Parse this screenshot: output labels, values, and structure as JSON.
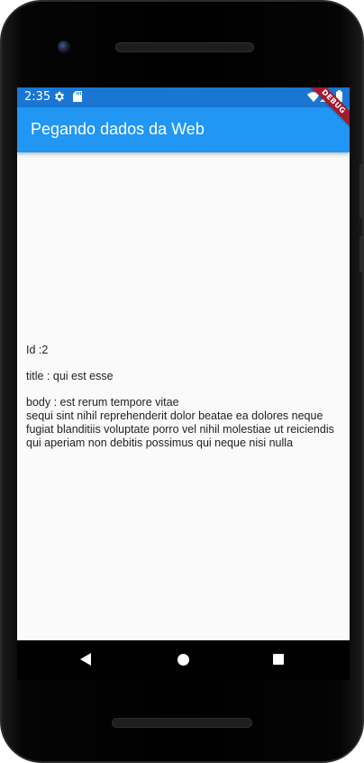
{
  "status_bar": {
    "time": "2:35",
    "icons": [
      "gear-icon",
      "sd-card-icon",
      "wifi-icon",
      "signal-icon",
      "battery-icon"
    ],
    "color": "#1976d2"
  },
  "app_bar": {
    "title": "Pegando dados da Web",
    "color": "#2196f3"
  },
  "debug_banner": {
    "label": "DEBUG"
  },
  "post": {
    "id_line": "Id :2",
    "title_line": "title : qui est esse",
    "body_line": "body : est rerum tempore vitae\nsequi sint nihil reprehenderit dolor beatae ea dolores neque fugiat blanditiis voluptate porro vel nihil molestiae ut reiciendis qui aperiam non debitis possimus qui neque nisi nulla"
  },
  "navigation": {
    "buttons": [
      "back-icon",
      "home-icon",
      "recent-apps-icon"
    ]
  }
}
